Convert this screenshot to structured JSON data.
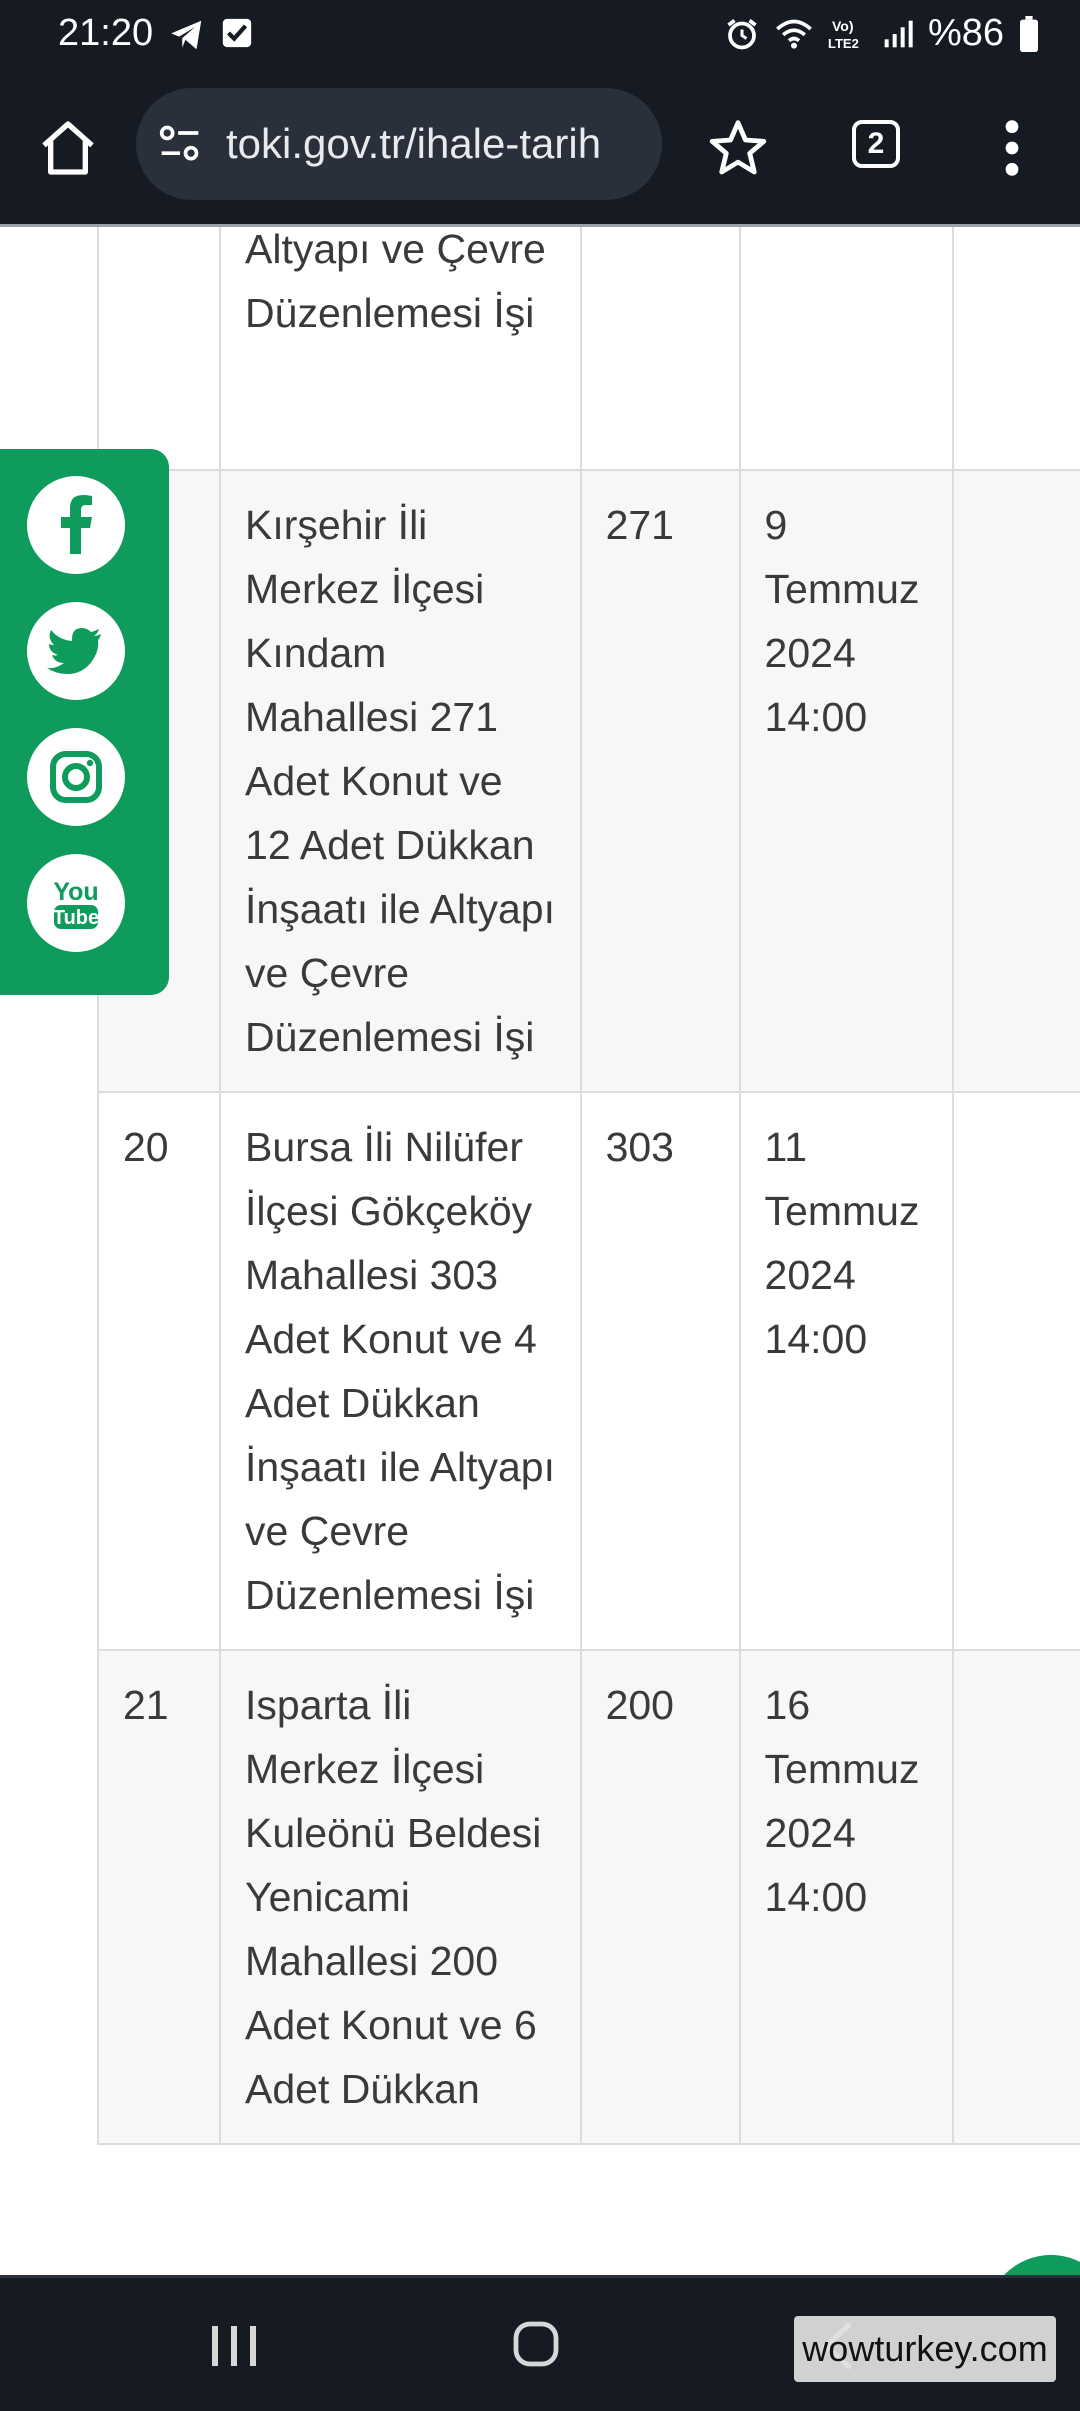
{
  "status_bar": {
    "time": "21:20",
    "battery": "%86",
    "icons": [
      "telegram-icon",
      "check-box-icon",
      "alarm-icon",
      "wifi-icon",
      "volte-lte2-icon",
      "signal-icon",
      "battery-icon"
    ]
  },
  "browser": {
    "url": "toki.gov.tr/ihale-tarih",
    "tab_count": "2"
  },
  "table": {
    "rows": [
      {
        "no": "",
        "desc": "Altyapı ve Çevre Düzenlemesi İşi",
        "qty": "",
        "date": ""
      },
      {
        "no": "",
        "desc": "Kırşehir İli Merkez İlçesi Kındam Mahallesi 271 Adet Konut ve 12 Adet Dükkan İnşaatı ile Altyapı ve Çevre Düzenlemesi İşi",
        "qty": "271",
        "date": "9 Temmuz 2024 14:00"
      },
      {
        "no": "20",
        "desc": "Bursa İli Nilüfer İlçesi Gökçeköy Mahallesi 303 Adet Konut ve 4 Adet Dükkan İnşaatı ile Altyapı ve Çevre Düzenlemesi İşi",
        "qty": "303",
        "date": "11 Temmuz 2024 14:00"
      },
      {
        "no": "21",
        "desc": "Isparta İli Merkez İlçesi Kuleönü Beldesi Yenicami Mahallesi 200 Adet Konut ve 6 Adet Dükkan",
        "qty": "200",
        "date": "16 Temmuz 2024 14:00"
      }
    ]
  },
  "social": [
    "facebook-icon",
    "twitter-icon",
    "instagram-icon",
    "youtube-icon"
  ],
  "youtube_label": {
    "line1": "You",
    "line2": "Tube"
  },
  "watermark": "wowturkey.com",
  "colors": {
    "brand_green": "#0e9b5c",
    "chrome_dark": "#151a23"
  }
}
